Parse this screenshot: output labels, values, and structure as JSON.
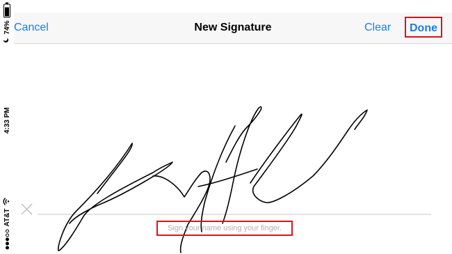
{
  "status_bar": {
    "carrier": "AT&T",
    "time": "4:33 PM",
    "battery": "74%",
    "battery_level": 0.74,
    "signal_dots": [
      true,
      true,
      true,
      false,
      false
    ]
  },
  "nav": {
    "cancel_label": "Cancel",
    "title": "New Signature",
    "clear_label": "Clear",
    "done_label": "Done"
  },
  "signature": {
    "hint": "Sign your name using your finger."
  },
  "colors": {
    "accent": "#1a7ee8",
    "highlight": "#d7141a",
    "nav_background": "#f7f7f7",
    "baseline": "#c8c8c8"
  },
  "icons": [
    "wifi-icon",
    "moon-icon",
    "battery-icon",
    "close-icon"
  ]
}
